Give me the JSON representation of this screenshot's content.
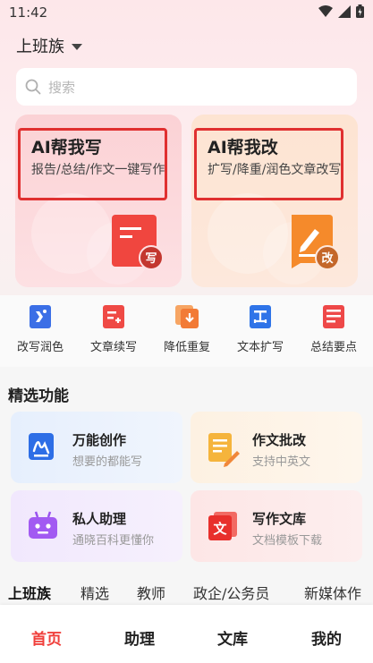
{
  "status": {
    "time": "11:42"
  },
  "header": {
    "category": "上班族"
  },
  "search": {
    "placeholder": "搜索"
  },
  "ai_cards": [
    {
      "title": "AI帮我写",
      "desc": "报告/总结/作文一键写作",
      "badge": "写"
    },
    {
      "title": "AI帮我改",
      "desc": "扩写/降重/润色文章改写",
      "badge": "改"
    }
  ],
  "quick_tools": [
    {
      "label": "改写润色",
      "icon": "rewrite-icon"
    },
    {
      "label": "文章续写",
      "icon": "continue-icon"
    },
    {
      "label": "降低重复",
      "icon": "dedup-icon"
    },
    {
      "label": "文本扩写",
      "icon": "expand-icon"
    },
    {
      "label": "总结要点",
      "icon": "summary-icon"
    }
  ],
  "featured": {
    "title": "精选功能",
    "items": [
      {
        "title": "万能创作",
        "sub": "想要的都能写",
        "icon": "create-icon"
      },
      {
        "title": "作文批改",
        "sub": "支持中英文",
        "icon": "grade-icon"
      },
      {
        "title": "私人助理",
        "sub": "通晓百科更懂你",
        "icon": "robot-icon"
      },
      {
        "title": "写作文库",
        "sub": "文档模板下载",
        "icon": "library-icon"
      }
    ]
  },
  "category_tabs": [
    "上班族",
    "精选",
    "教师",
    "政企/公务员",
    "新媒体作"
  ],
  "bottom_nav": [
    "首页",
    "助理",
    "文库",
    "我的"
  ],
  "colors": {
    "accent": "#f0403c",
    "highlight": "#e03030"
  }
}
